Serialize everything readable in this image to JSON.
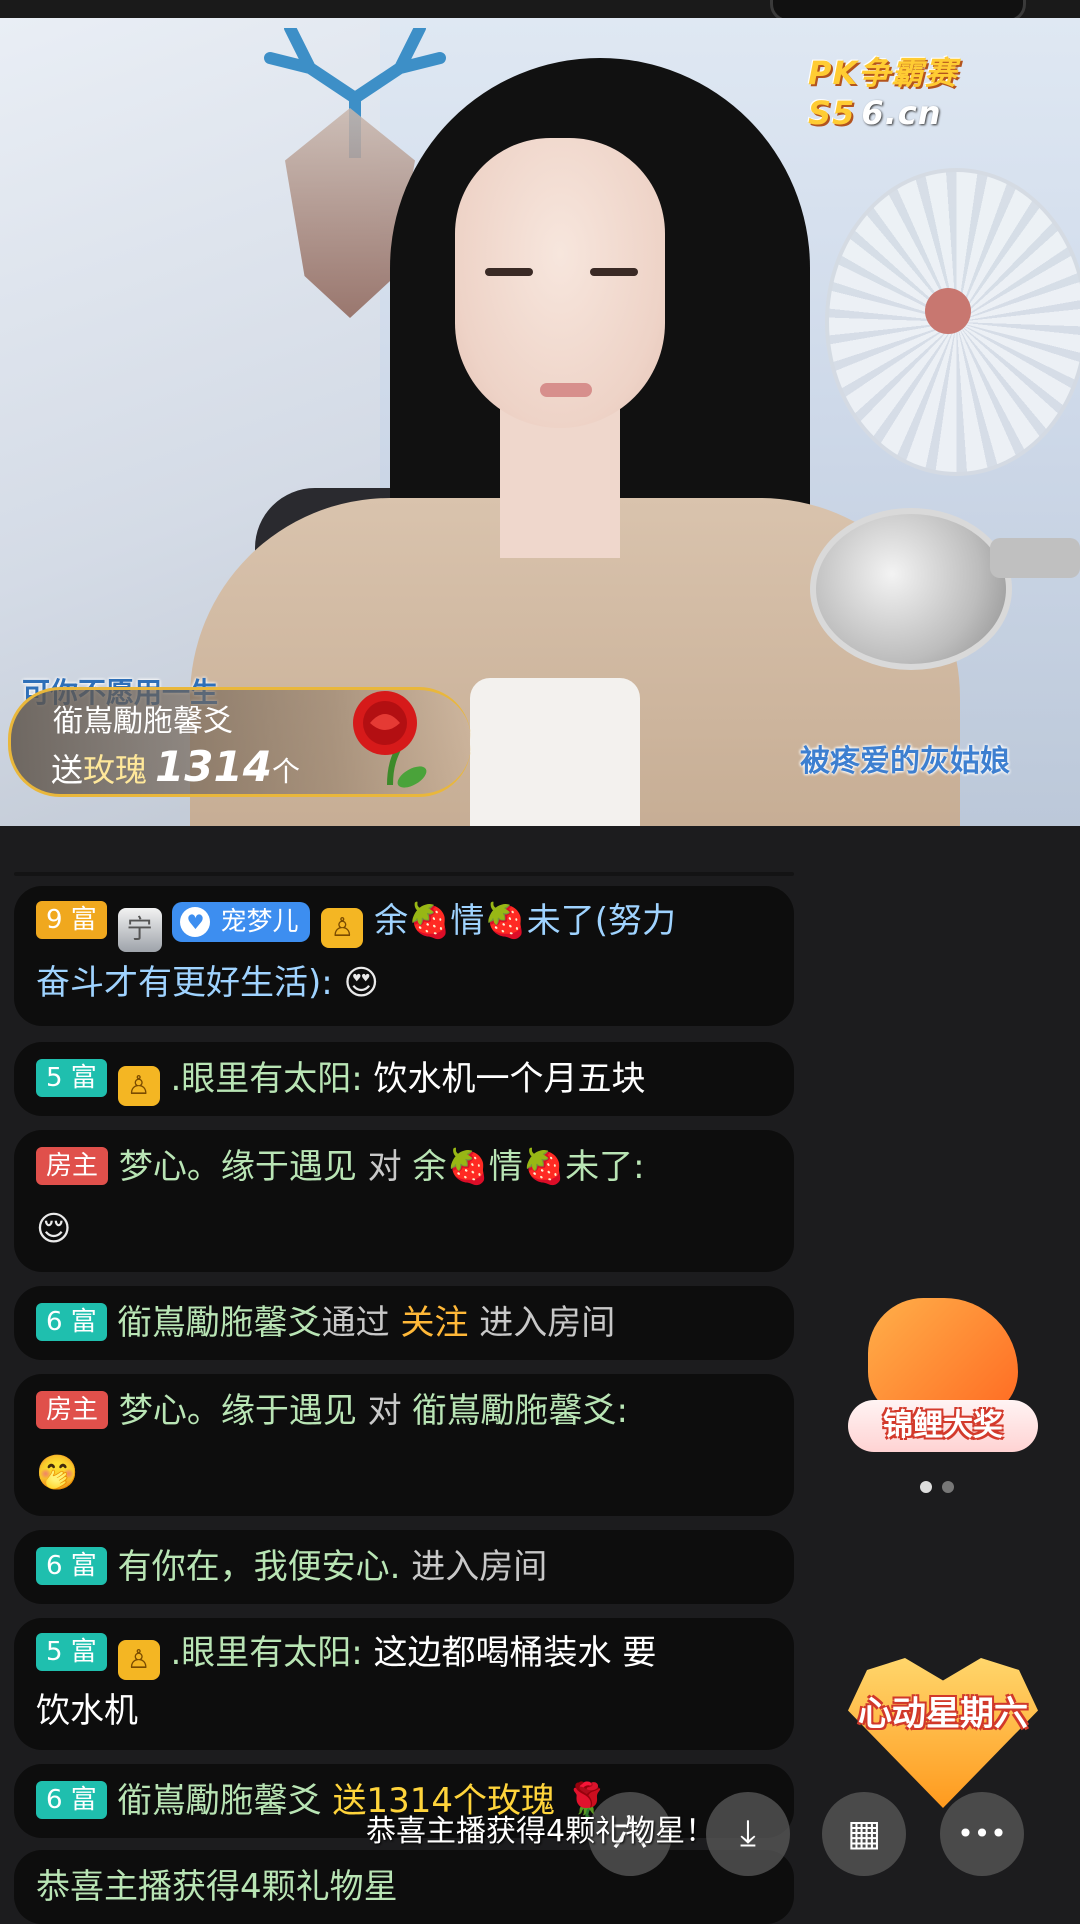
{
  "stream": {
    "logo_text": "PK争霸赛S5",
    "logo_domain": "6.cn",
    "song_title": "可你不愿用一生",
    "streamer_name": "被疼爱的灰姑娘"
  },
  "gift_banner": {
    "sender": "衜嶌勵胣馨爻",
    "prefix": "送",
    "gift_name": "玫瑰",
    "count": "1314",
    "unit": "个",
    "gift_icon": "rose-icon"
  },
  "chat": [
    {
      "level": "9 富",
      "medal": "宁",
      "fanclub": "宠梦儿",
      "name": "余🍓情🍓未了(努力",
      "name_cont": "奋斗才有更好生活):",
      "emoji": "😍"
    },
    {
      "level": "5 富",
      "name": ".眼里有太阳:",
      "text": "饮水机一个月五块"
    },
    {
      "level": "房主",
      "name": "梦心。缘于遇见",
      "mid": "对",
      "target": "余🍓情🍓未了:",
      "emoji": "😌"
    },
    {
      "level": "6 富",
      "name": "衜嶌勵胣馨爻",
      "mid": "通过",
      "action": "关注",
      "tail": "进入房间"
    },
    {
      "level": "房主",
      "name": "梦心。缘于遇见",
      "mid": "对",
      "target": "衜嶌勵胣馨爻:",
      "emoji": "🤭"
    },
    {
      "level": "6 富",
      "name": "有你在，我便安心.",
      "tail": "进入房间"
    },
    {
      "level": "5 富",
      "name": ".眼里有太阳:",
      "text": "这边都喝桶装水 要",
      "text_cont": "饮水机"
    },
    {
      "level": "6 富",
      "name": "衜嶌勵胣馨爻",
      "gift_text": "送1314个玫瑰"
    },
    {
      "system": "恭喜主播获得4颗礼物星"
    }
  ],
  "activities": {
    "koi_label": "锦鲤大奖",
    "saturday_label": "心动星期六"
  },
  "toast": "恭喜主播获得4颗礼物星！",
  "controls": {
    "share_icon": "六",
    "download_icon": "⤓",
    "grid_icon": "▦",
    "more_icon": "•••"
  }
}
